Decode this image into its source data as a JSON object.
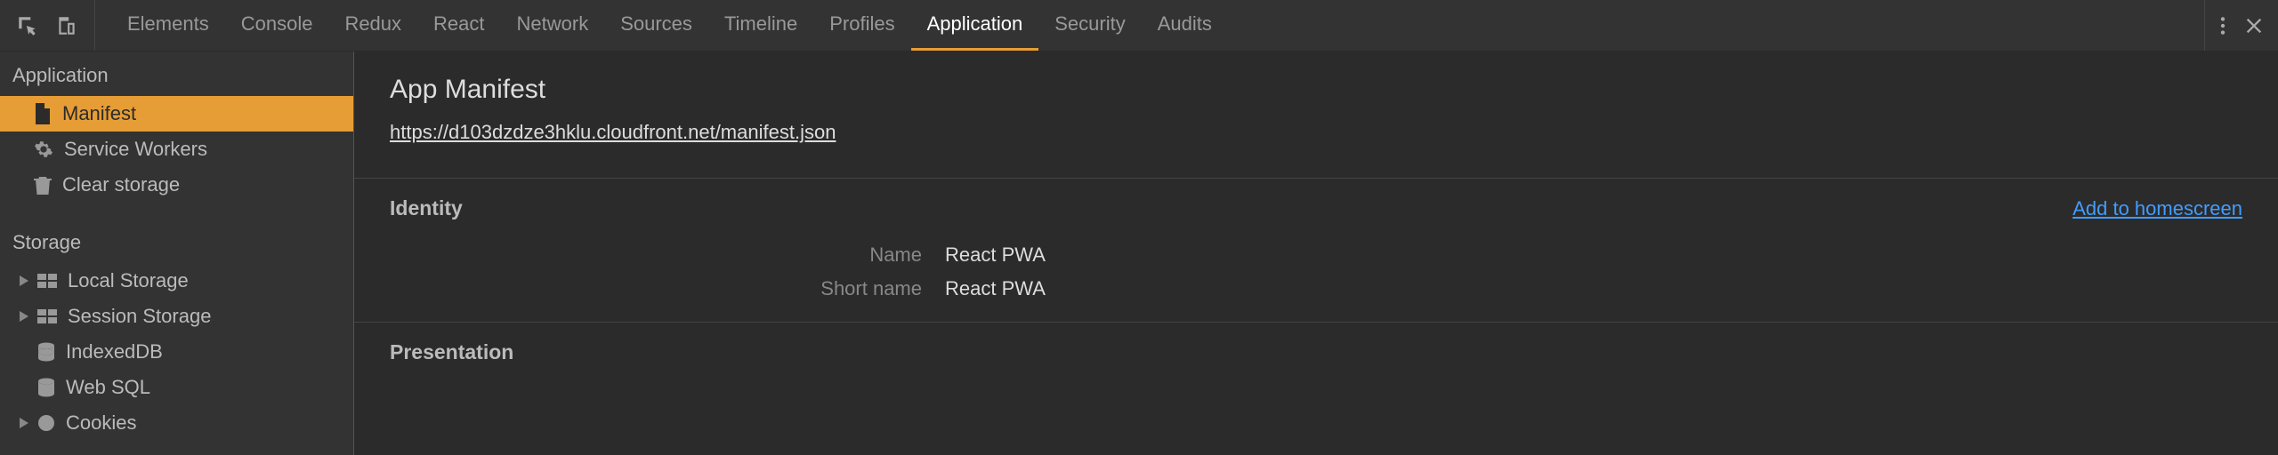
{
  "toolbar": {
    "tabs": [
      "Elements",
      "Console",
      "Redux",
      "React",
      "Network",
      "Sources",
      "Timeline",
      "Profiles",
      "Application",
      "Security",
      "Audits"
    ],
    "activeTab": "Application"
  },
  "sidebar": {
    "sections": {
      "application": {
        "title": "Application",
        "items": [
          "Manifest",
          "Service Workers",
          "Clear storage"
        ],
        "selected": "Manifest"
      },
      "storage": {
        "title": "Storage",
        "items": [
          "Local Storage",
          "Session Storage",
          "IndexedDB",
          "Web SQL",
          "Cookies"
        ]
      }
    }
  },
  "main": {
    "title": "App Manifest",
    "manifest_url": "https://d103dzdze3hklu.cloudfront.net/manifest.json",
    "identity": {
      "title": "Identity",
      "add_link": "Add to homescreen",
      "fields": {
        "name_label": "Name",
        "name_value": "React PWA",
        "short_name_label": "Short name",
        "short_name_value": "React PWA"
      }
    },
    "presentation": {
      "title": "Presentation"
    }
  }
}
